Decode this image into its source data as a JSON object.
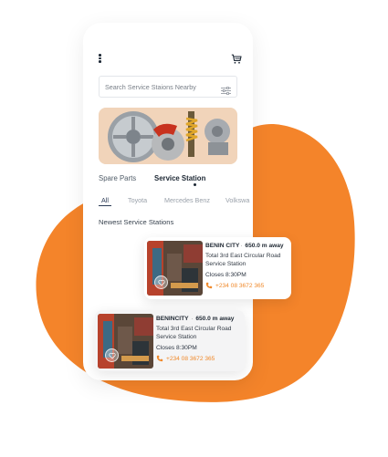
{
  "colors": {
    "accent": "#f4842a",
    "primary_text": "#1c2733",
    "phone_text": "#f0892a"
  },
  "icons": {
    "menu": "more-vertical-icon",
    "cart": "cart-icon",
    "filter": "sliders-icon",
    "favorite": "heart-icon",
    "phone": "phone-icon"
  },
  "search": {
    "placeholder": "Search Service Staions Nearby"
  },
  "category_tabs": [
    {
      "label": "Spare Parts",
      "active": false
    },
    {
      "label": "Service Station",
      "active": true
    }
  ],
  "brand_tabs": [
    {
      "label": "All",
      "active": true
    },
    {
      "label": "Toyota",
      "active": false
    },
    {
      "label": "Mercedes Benz",
      "active": false
    },
    {
      "label": "Volkswa",
      "active": false
    }
  ],
  "section_title": "Newest Service Stations",
  "stations": [
    {
      "city": "BENIN CITY",
      "separator": "·",
      "distance": "650.0 m away",
      "name": "Total 3rd East Circular Road Service Station",
      "hours": "Closes 8:30PM",
      "phone": "+234 08 3672 365"
    },
    {
      "city": "BENINCITY",
      "separator": "·",
      "distance": "650.0 m away",
      "name": "Total 3rd East Circular Road Service Station",
      "hours": "Closes 8:30PM",
      "phone": "+234 08 3672 365"
    }
  ]
}
